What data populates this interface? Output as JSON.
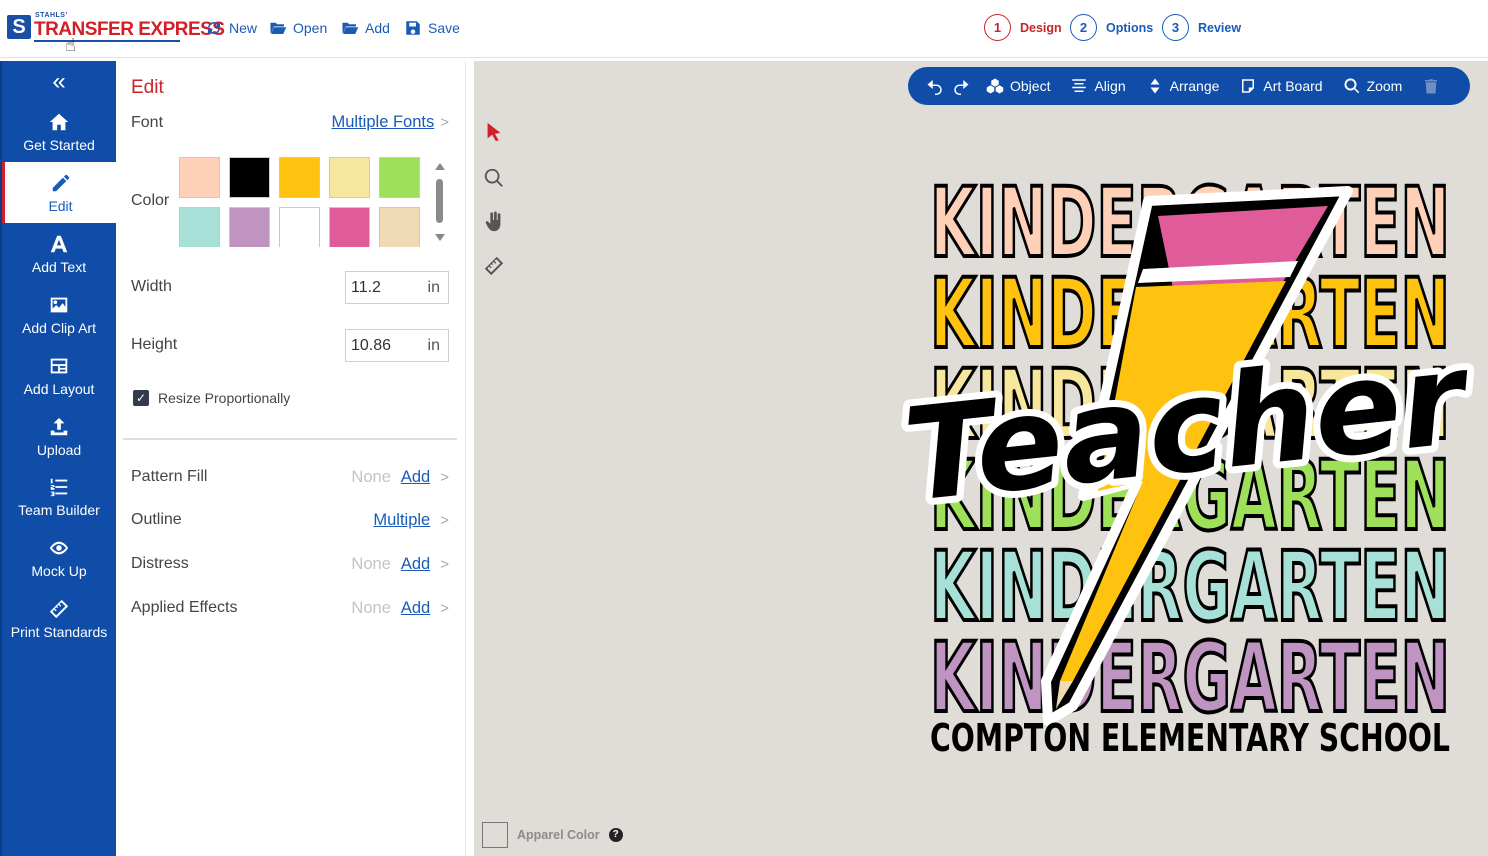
{
  "header": {
    "logo_small": "STAHLS'",
    "logo_text": "TRANSFER EXPRESS",
    "actions": [
      {
        "label": "New",
        "icon": "refresh-icon"
      },
      {
        "label": "Open",
        "icon": "folder-open-icon"
      },
      {
        "label": "Add",
        "icon": "folder-add-icon"
      },
      {
        "label": "Save",
        "icon": "save-icon"
      }
    ],
    "steps": [
      {
        "num": "1",
        "label": "Design",
        "active": true
      },
      {
        "num": "2",
        "label": "Options",
        "active": false
      },
      {
        "num": "3",
        "label": "Review",
        "active": false
      }
    ]
  },
  "sidebar": {
    "collapse_icon": "double-chevron-left-icon",
    "items": [
      {
        "label": "Get Started",
        "icon": "home-icon"
      },
      {
        "label": "Edit",
        "icon": "pencil-icon",
        "active": true
      },
      {
        "label": "Add Text",
        "icon": "text-a-icon"
      },
      {
        "label": "Add Clip Art",
        "icon": "image-icon"
      },
      {
        "label": "Add Layout",
        "icon": "layout-icon"
      },
      {
        "label": "Upload",
        "icon": "upload-icon"
      },
      {
        "label": "Team Builder",
        "icon": "list-numbered-icon"
      },
      {
        "label": "Mock Up",
        "icon": "eye-icon"
      },
      {
        "label": "Print Standards",
        "icon": "ruler-icon"
      }
    ]
  },
  "edit_panel": {
    "title": "Edit",
    "font_label": "Font",
    "font_value": "Multiple Fonts",
    "color_label": "Color",
    "colors": [
      "#ffd0b8",
      "#000000",
      "#ffc20e",
      "#f7e79c",
      "#9fe05a",
      "#a6e0d6",
      "#bf94c1",
      "#ffffff",
      "#e05c99",
      "#efdab4"
    ],
    "width_label": "Width",
    "width_value": "11.2",
    "height_label": "Height",
    "height_value": "10.86",
    "unit": "in",
    "resize_label": "Resize Proportionally",
    "pattern_fill_label": "Pattern Fill",
    "outline_label": "Outline",
    "outline_value": "Multiple",
    "distress_label": "Distress",
    "applied_effects_label": "Applied Effects",
    "none_text": "None",
    "add_text": "Add"
  },
  "canvas": {
    "side_tools": [
      "select-arrow-icon",
      "magnify-icon",
      "hand-icon",
      "ruler-icon"
    ],
    "toolbar": [
      {
        "label": "",
        "icon": "undo-icon"
      },
      {
        "label": "",
        "icon": "redo-icon"
      },
      {
        "label": "Object",
        "icon": "object-icon"
      },
      {
        "label": "Align",
        "icon": "align-icon"
      },
      {
        "label": "Arrange",
        "icon": "arrange-icon"
      },
      {
        "label": "Art Board",
        "icon": "artboard-icon"
      },
      {
        "label": "Zoom",
        "icon": "search-icon"
      },
      {
        "label": "",
        "icon": "trash-icon"
      }
    ],
    "apparel_label": "Apparel Color",
    "design": {
      "word": "KINDERGARTEN",
      "script": "Teacher",
      "school": "COMPTON ELEMENTARY SCHOOL",
      "row_colors": [
        "#ffd0b8",
        "#ffc20e",
        "#f7e79c",
        "#9fe05a",
        "#a6e0d6",
        "#bf94c1"
      ]
    }
  }
}
